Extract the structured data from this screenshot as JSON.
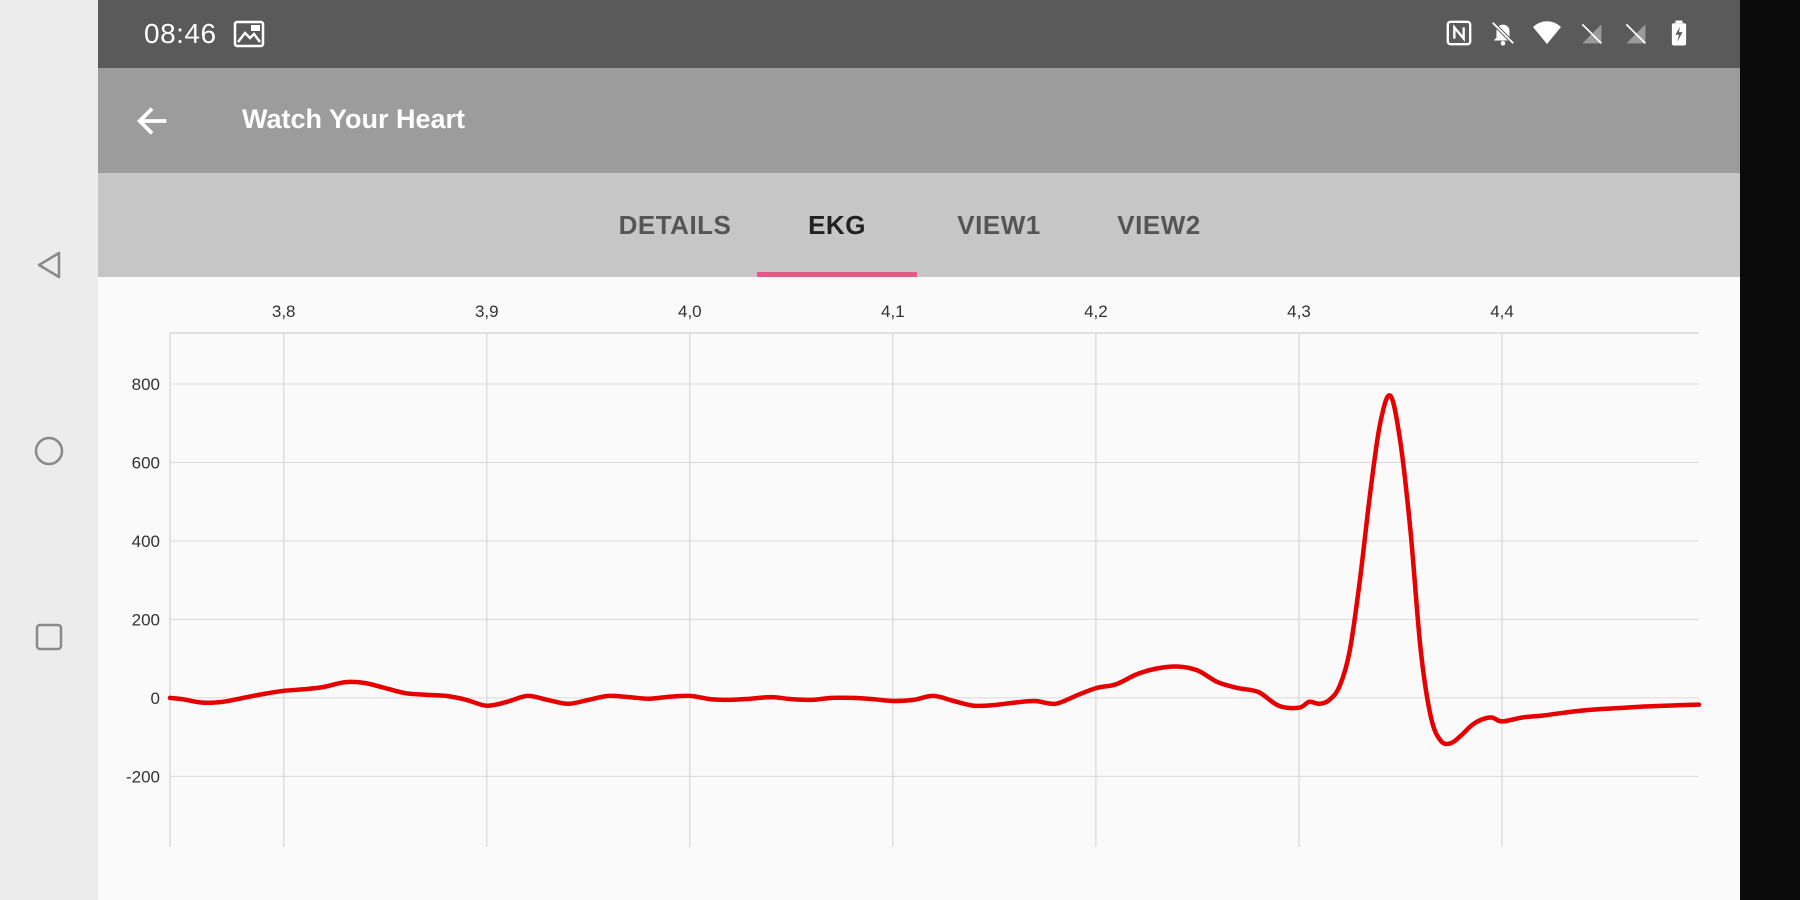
{
  "status": {
    "time": "08:46",
    "icons": [
      "gallery-icon",
      "nfc-icon",
      "bell-off-icon",
      "wifi-icon",
      "no-sim-icon",
      "no-sim-icon",
      "battery-icon"
    ]
  },
  "appbar": {
    "title": "Watch Your Heart"
  },
  "tabs": [
    {
      "label": "DETAILS",
      "active": false
    },
    {
      "label": "EKG",
      "active": true
    },
    {
      "label": "VIEW1",
      "active": false
    },
    {
      "label": "VIEW2",
      "active": false
    }
  ],
  "colors": {
    "accent": "#e05a86",
    "line": "#e60000",
    "statusbar": "#5a5a5a",
    "appbar": "#9c9c9c",
    "tabbar": "#c6c6c6"
  },
  "chart_data": {
    "type": "line",
    "title": "",
    "xlabel": "",
    "ylabel": "",
    "x_ticks": [
      "3,8",
      "3,9",
      "4,0",
      "4,1",
      "4,2",
      "4,3",
      "4,4"
    ],
    "x_tick_values": [
      3.8,
      3.9,
      4.0,
      4.1,
      4.2,
      4.3,
      4.4
    ],
    "y_ticks": [
      "800",
      "600",
      "400",
      "200",
      "0",
      "-200"
    ],
    "y_tick_values": [
      800,
      600,
      400,
      200,
      0,
      -200
    ],
    "xlim": [
      3.744,
      4.497
    ],
    "ylim": [
      -380,
      930
    ],
    "x_axis_position": "top",
    "grid": true,
    "series": [
      {
        "name": "",
        "x": [
          3.744,
          3.75,
          3.76,
          3.77,
          3.78,
          3.79,
          3.8,
          3.81,
          3.82,
          3.83,
          3.84,
          3.85,
          3.86,
          3.87,
          3.88,
          3.89,
          3.9,
          3.91,
          3.92,
          3.93,
          3.94,
          3.95,
          3.96,
          3.97,
          3.98,
          3.99,
          4.0,
          4.01,
          4.02,
          4.03,
          4.04,
          4.05,
          4.06,
          4.07,
          4.08,
          4.09,
          4.1,
          4.11,
          4.12,
          4.13,
          4.14,
          4.15,
          4.16,
          4.17,
          4.18,
          4.19,
          4.2,
          4.21,
          4.22,
          4.23,
          4.24,
          4.25,
          4.26,
          4.27,
          4.28,
          4.29,
          4.3,
          4.305,
          4.31,
          4.315,
          4.32,
          4.325,
          4.33,
          4.335,
          4.34,
          4.345,
          4.35,
          4.355,
          4.36,
          4.365,
          4.37,
          4.375,
          4.38,
          4.385,
          4.39,
          4.395,
          4.4,
          4.41,
          4.42,
          4.43,
          4.44,
          4.45,
          4.46,
          4.47,
          4.48,
          4.49,
          4.497
        ],
        "values": [
          0,
          -3,
          -12,
          -10,
          0,
          10,
          18,
          22,
          28,
          40,
          38,
          25,
          12,
          8,
          5,
          -5,
          -20,
          -10,
          5,
          -5,
          -15,
          -5,
          5,
          2,
          -2,
          3,
          5,
          -3,
          -5,
          -2,
          2,
          -3,
          -5,
          0,
          0,
          -3,
          -8,
          -5,
          5,
          -8,
          -20,
          -18,
          -12,
          -8,
          -15,
          5,
          25,
          35,
          60,
          75,
          80,
          70,
          40,
          25,
          15,
          -20,
          -25,
          -10,
          -15,
          -5,
          30,
          120,
          300,
          520,
          700,
          770,
          650,
          420,
          120,
          -50,
          -110,
          -115,
          -95,
          -70,
          -55,
          -50,
          -60,
          -50,
          -45,
          -38,
          -32,
          -28,
          -25,
          -22,
          -20,
          -18,
          -17
        ]
      }
    ]
  }
}
